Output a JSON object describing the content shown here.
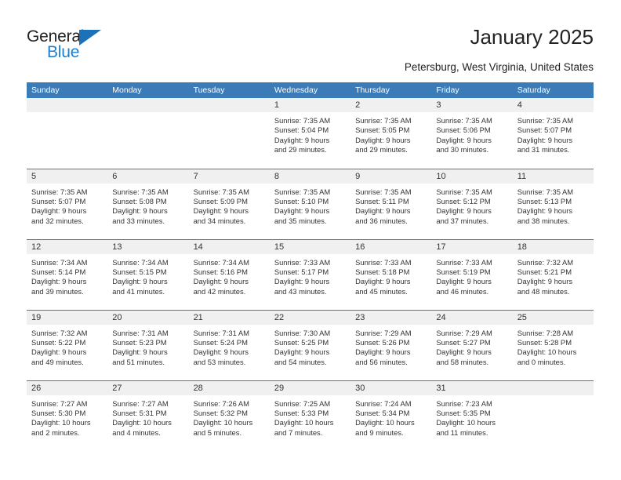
{
  "brand": {
    "name_top": "General",
    "name_bottom": "Blue",
    "triangle_icon": "triangle-logo-icon",
    "colors": {
      "blue": "#1c7fd4",
      "dark": "#231f20",
      "triangle": "#1b72b8"
    }
  },
  "header": {
    "title": "January 2025",
    "location": "Petersburg, West Virginia, United States"
  },
  "theme": {
    "header_bg": "#3b7cb8",
    "daynum_bg": "#f0f0f0",
    "row_divider": "#3b7cb8",
    "text": "#333333"
  },
  "weekday_headers": [
    "Sunday",
    "Monday",
    "Tuesday",
    "Wednesday",
    "Thursday",
    "Friday",
    "Saturday"
  ],
  "weeks": [
    [
      {
        "day": "",
        "empty": true,
        "sunrise": "",
        "sunset": "",
        "daylight_line1": "",
        "daylight_line2": ""
      },
      {
        "day": "",
        "empty": true,
        "sunrise": "",
        "sunset": "",
        "daylight_line1": "",
        "daylight_line2": ""
      },
      {
        "day": "",
        "empty": true,
        "sunrise": "",
        "sunset": "",
        "daylight_line1": "",
        "daylight_line2": ""
      },
      {
        "day": "1",
        "empty": false,
        "sunrise": "Sunrise: 7:35 AM",
        "sunset": "Sunset: 5:04 PM",
        "daylight_line1": "Daylight: 9 hours",
        "daylight_line2": "and 29 minutes."
      },
      {
        "day": "2",
        "empty": false,
        "sunrise": "Sunrise: 7:35 AM",
        "sunset": "Sunset: 5:05 PM",
        "daylight_line1": "Daylight: 9 hours",
        "daylight_line2": "and 29 minutes."
      },
      {
        "day": "3",
        "empty": false,
        "sunrise": "Sunrise: 7:35 AM",
        "sunset": "Sunset: 5:06 PM",
        "daylight_line1": "Daylight: 9 hours",
        "daylight_line2": "and 30 minutes."
      },
      {
        "day": "4",
        "empty": false,
        "sunrise": "Sunrise: 7:35 AM",
        "sunset": "Sunset: 5:07 PM",
        "daylight_line1": "Daylight: 9 hours",
        "daylight_line2": "and 31 minutes."
      }
    ],
    [
      {
        "day": "5",
        "empty": false,
        "sunrise": "Sunrise: 7:35 AM",
        "sunset": "Sunset: 5:07 PM",
        "daylight_line1": "Daylight: 9 hours",
        "daylight_line2": "and 32 minutes."
      },
      {
        "day": "6",
        "empty": false,
        "sunrise": "Sunrise: 7:35 AM",
        "sunset": "Sunset: 5:08 PM",
        "daylight_line1": "Daylight: 9 hours",
        "daylight_line2": "and 33 minutes."
      },
      {
        "day": "7",
        "empty": false,
        "sunrise": "Sunrise: 7:35 AM",
        "sunset": "Sunset: 5:09 PM",
        "daylight_line1": "Daylight: 9 hours",
        "daylight_line2": "and 34 minutes."
      },
      {
        "day": "8",
        "empty": false,
        "sunrise": "Sunrise: 7:35 AM",
        "sunset": "Sunset: 5:10 PM",
        "daylight_line1": "Daylight: 9 hours",
        "daylight_line2": "and 35 minutes."
      },
      {
        "day": "9",
        "empty": false,
        "sunrise": "Sunrise: 7:35 AM",
        "sunset": "Sunset: 5:11 PM",
        "daylight_line1": "Daylight: 9 hours",
        "daylight_line2": "and 36 minutes."
      },
      {
        "day": "10",
        "empty": false,
        "sunrise": "Sunrise: 7:35 AM",
        "sunset": "Sunset: 5:12 PM",
        "daylight_line1": "Daylight: 9 hours",
        "daylight_line2": "and 37 minutes."
      },
      {
        "day": "11",
        "empty": false,
        "sunrise": "Sunrise: 7:35 AM",
        "sunset": "Sunset: 5:13 PM",
        "daylight_line1": "Daylight: 9 hours",
        "daylight_line2": "and 38 minutes."
      }
    ],
    [
      {
        "day": "12",
        "empty": false,
        "sunrise": "Sunrise: 7:34 AM",
        "sunset": "Sunset: 5:14 PM",
        "daylight_line1": "Daylight: 9 hours",
        "daylight_line2": "and 39 minutes."
      },
      {
        "day": "13",
        "empty": false,
        "sunrise": "Sunrise: 7:34 AM",
        "sunset": "Sunset: 5:15 PM",
        "daylight_line1": "Daylight: 9 hours",
        "daylight_line2": "and 41 minutes."
      },
      {
        "day": "14",
        "empty": false,
        "sunrise": "Sunrise: 7:34 AM",
        "sunset": "Sunset: 5:16 PM",
        "daylight_line1": "Daylight: 9 hours",
        "daylight_line2": "and 42 minutes."
      },
      {
        "day": "15",
        "empty": false,
        "sunrise": "Sunrise: 7:33 AM",
        "sunset": "Sunset: 5:17 PM",
        "daylight_line1": "Daylight: 9 hours",
        "daylight_line2": "and 43 minutes."
      },
      {
        "day": "16",
        "empty": false,
        "sunrise": "Sunrise: 7:33 AM",
        "sunset": "Sunset: 5:18 PM",
        "daylight_line1": "Daylight: 9 hours",
        "daylight_line2": "and 45 minutes."
      },
      {
        "day": "17",
        "empty": false,
        "sunrise": "Sunrise: 7:33 AM",
        "sunset": "Sunset: 5:19 PM",
        "daylight_line1": "Daylight: 9 hours",
        "daylight_line2": "and 46 minutes."
      },
      {
        "day": "18",
        "empty": false,
        "sunrise": "Sunrise: 7:32 AM",
        "sunset": "Sunset: 5:21 PM",
        "daylight_line1": "Daylight: 9 hours",
        "daylight_line2": "and 48 minutes."
      }
    ],
    [
      {
        "day": "19",
        "empty": false,
        "sunrise": "Sunrise: 7:32 AM",
        "sunset": "Sunset: 5:22 PM",
        "daylight_line1": "Daylight: 9 hours",
        "daylight_line2": "and 49 minutes."
      },
      {
        "day": "20",
        "empty": false,
        "sunrise": "Sunrise: 7:31 AM",
        "sunset": "Sunset: 5:23 PM",
        "daylight_line1": "Daylight: 9 hours",
        "daylight_line2": "and 51 minutes."
      },
      {
        "day": "21",
        "empty": false,
        "sunrise": "Sunrise: 7:31 AM",
        "sunset": "Sunset: 5:24 PM",
        "daylight_line1": "Daylight: 9 hours",
        "daylight_line2": "and 53 minutes."
      },
      {
        "day": "22",
        "empty": false,
        "sunrise": "Sunrise: 7:30 AM",
        "sunset": "Sunset: 5:25 PM",
        "daylight_line1": "Daylight: 9 hours",
        "daylight_line2": "and 54 minutes."
      },
      {
        "day": "23",
        "empty": false,
        "sunrise": "Sunrise: 7:29 AM",
        "sunset": "Sunset: 5:26 PM",
        "daylight_line1": "Daylight: 9 hours",
        "daylight_line2": "and 56 minutes."
      },
      {
        "day": "24",
        "empty": false,
        "sunrise": "Sunrise: 7:29 AM",
        "sunset": "Sunset: 5:27 PM",
        "daylight_line1": "Daylight: 9 hours",
        "daylight_line2": "and 58 minutes."
      },
      {
        "day": "25",
        "empty": false,
        "sunrise": "Sunrise: 7:28 AM",
        "sunset": "Sunset: 5:28 PM",
        "daylight_line1": "Daylight: 10 hours",
        "daylight_line2": "and 0 minutes."
      }
    ],
    [
      {
        "day": "26",
        "empty": false,
        "sunrise": "Sunrise: 7:27 AM",
        "sunset": "Sunset: 5:30 PM",
        "daylight_line1": "Daylight: 10 hours",
        "daylight_line2": "and 2 minutes."
      },
      {
        "day": "27",
        "empty": false,
        "sunrise": "Sunrise: 7:27 AM",
        "sunset": "Sunset: 5:31 PM",
        "daylight_line1": "Daylight: 10 hours",
        "daylight_line2": "and 4 minutes."
      },
      {
        "day": "28",
        "empty": false,
        "sunrise": "Sunrise: 7:26 AM",
        "sunset": "Sunset: 5:32 PM",
        "daylight_line1": "Daylight: 10 hours",
        "daylight_line2": "and 5 minutes."
      },
      {
        "day": "29",
        "empty": false,
        "sunrise": "Sunrise: 7:25 AM",
        "sunset": "Sunset: 5:33 PM",
        "daylight_line1": "Daylight: 10 hours",
        "daylight_line2": "and 7 minutes."
      },
      {
        "day": "30",
        "empty": false,
        "sunrise": "Sunrise: 7:24 AM",
        "sunset": "Sunset: 5:34 PM",
        "daylight_line1": "Daylight: 10 hours",
        "daylight_line2": "and 9 minutes."
      },
      {
        "day": "31",
        "empty": false,
        "sunrise": "Sunrise: 7:23 AM",
        "sunset": "Sunset: 5:35 PM",
        "daylight_line1": "Daylight: 10 hours",
        "daylight_line2": "and 11 minutes."
      },
      {
        "day": "",
        "empty": true,
        "sunrise": "",
        "sunset": "",
        "daylight_line1": "",
        "daylight_line2": ""
      }
    ]
  ]
}
